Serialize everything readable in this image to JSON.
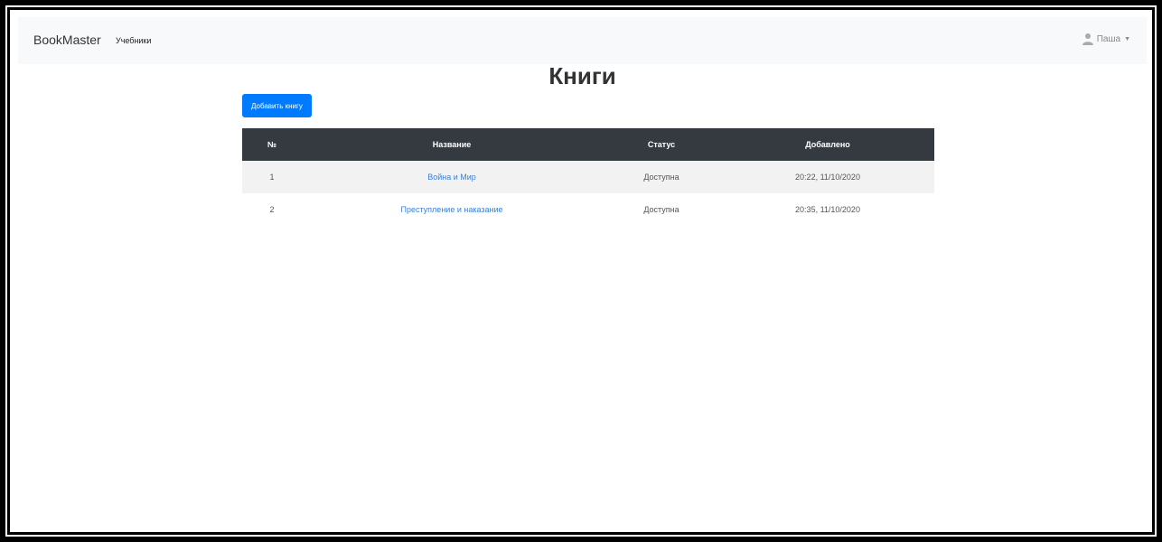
{
  "navbar": {
    "brand": "BookMaster",
    "link": "Учебники",
    "user_name": "Паша"
  },
  "page": {
    "title": "Книги",
    "add_button": "Добавить книгу"
  },
  "table": {
    "headers": [
      "№",
      "Название",
      "Статус",
      "Добавлено"
    ],
    "rows": [
      {
        "num": "1",
        "title": "Война и Мир",
        "status": "Доступна",
        "added": "20:22, 11/10/2020"
      },
      {
        "num": "2",
        "title": "Преступление и наказание",
        "status": "Доступна",
        "added": "20:35, 11/10/2020"
      }
    ]
  }
}
